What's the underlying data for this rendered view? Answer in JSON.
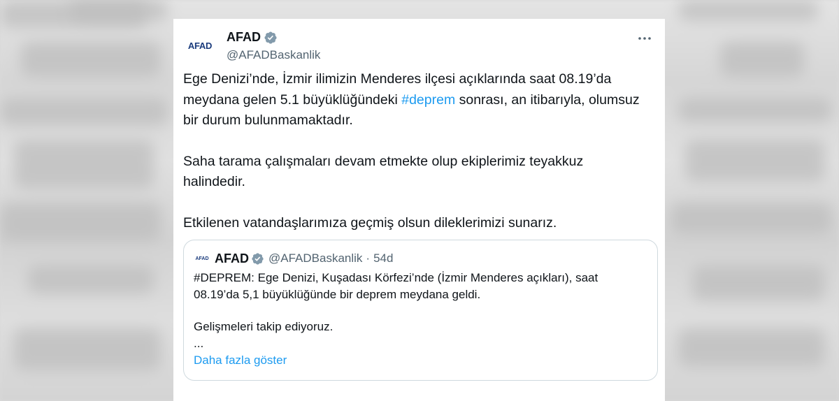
{
  "tweet": {
    "author_name": "AFAD",
    "handle": "@AFADBaskanlik",
    "avatar_text": "AFAD",
    "more_icon": "more-icon",
    "paragraphs": [
      {
        "before": "Ege Denizi’nde, İzmir ilimizin Menderes ilçesi açıklarında saat 08.19’da meydana gelen 5.1 büyüklüğündeki ",
        "hashtag": "#deprem",
        "after": " sonrası, an itibarıyla, olumsuz bir durum bulunmamaktadır."
      },
      {
        "text": "Saha tarama çalışmaları devam etmekte olup ekiplerimiz teyakkuz halindedir."
      },
      {
        "text": "Etkilenen vatandaşlarımıza geçmiş olsun dileklerimizi sunarız."
      }
    ]
  },
  "quoted": {
    "author_name": "AFAD",
    "handle": "@AFADBaskanlik",
    "separator": "·",
    "time": "54d",
    "avatar_text": "AFAD",
    "lines": [
      "#DEPREM: Ege Denizi, Kuşadası Körfezi’nde (İzmir Menderes açıkları), saat 08.19’da 5,1 büyüklüğünde bir deprem meydana geldi.",
      "Gelişmeleri takip ediyoruz.",
      "..."
    ],
    "show_more": "Daha fazla göster"
  },
  "colors": {
    "link": "#1d9bf0",
    "verified_badge": "#829aab",
    "text": "#0f1419",
    "secondary": "#536471"
  }
}
